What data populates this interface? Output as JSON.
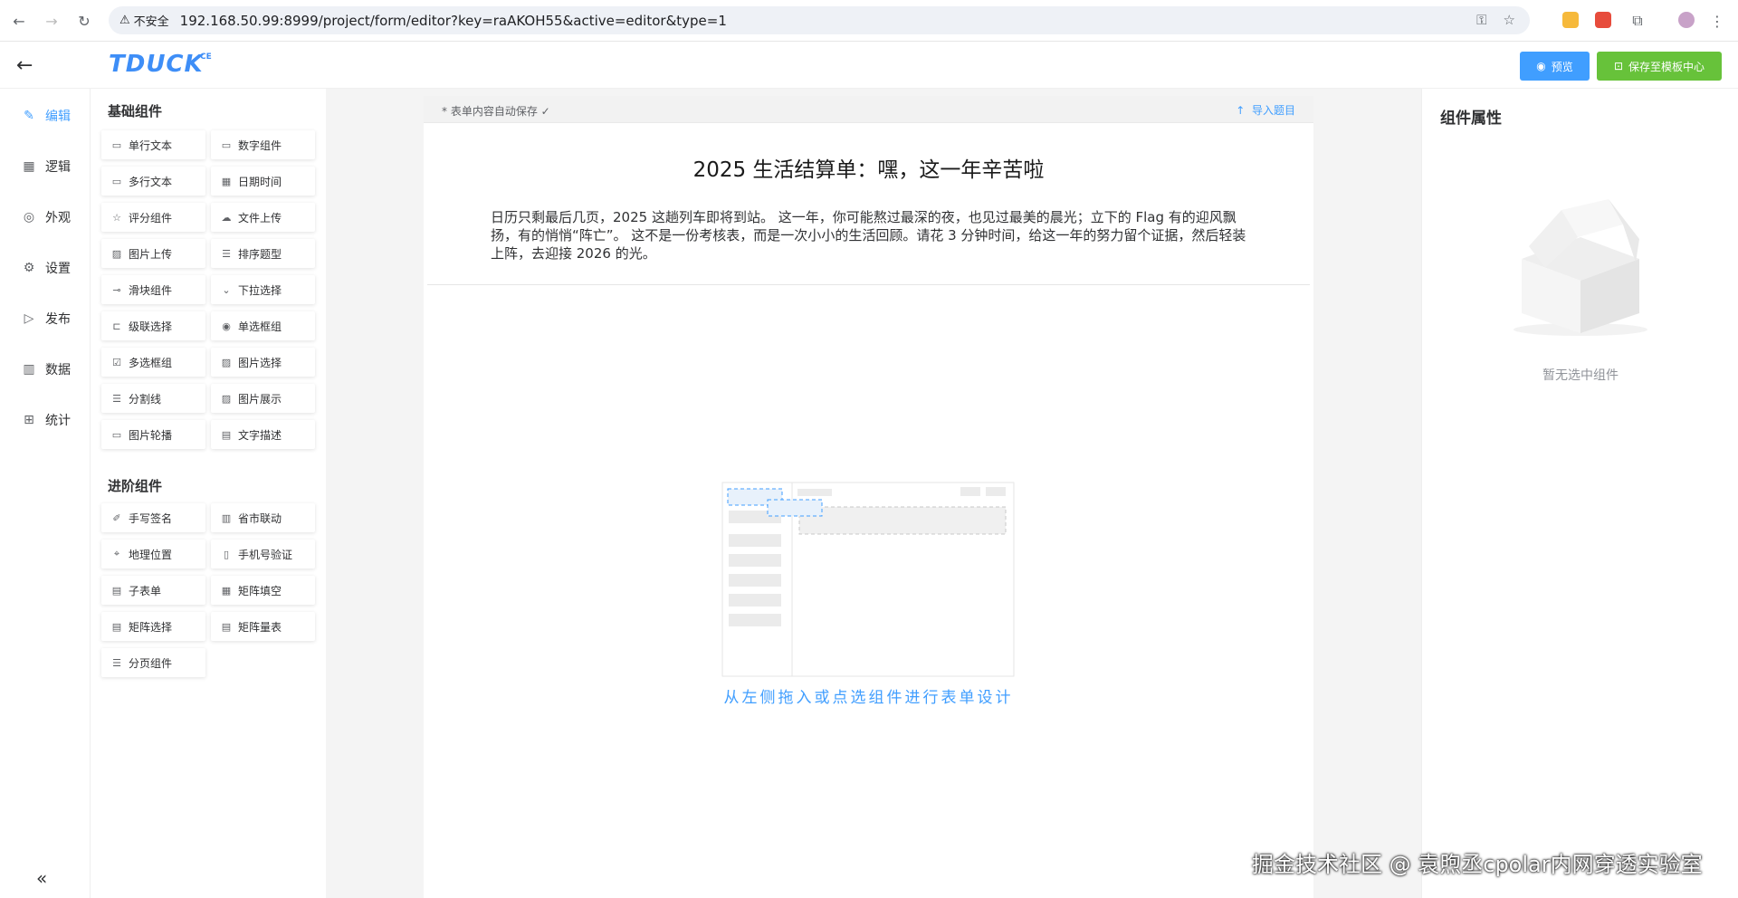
{
  "browser": {
    "insecure_label": "不安全",
    "url": "192.168.50.99:8999/project/form/editor?key=raAKOH55&active=editor&type=1"
  },
  "header": {
    "logo": "TDUCK",
    "logo_sup": "CE",
    "preview_label": "预览",
    "save_template_label": "保存至模板中心"
  },
  "left_menu": {
    "items": [
      {
        "label": "编辑",
        "icon": "edit-icon",
        "active": true
      },
      {
        "label": "逻辑",
        "icon": "logic-icon"
      },
      {
        "label": "外观",
        "icon": "eye-icon"
      },
      {
        "label": "设置",
        "icon": "gear-icon"
      },
      {
        "label": "发布",
        "icon": "publish-icon"
      },
      {
        "label": "数据",
        "icon": "bar-chart-icon"
      },
      {
        "label": "统计",
        "icon": "stats-icon"
      }
    ]
  },
  "components": {
    "basic_title": "基础组件",
    "basic": [
      {
        "label": "单行文本",
        "icon": "input-icon"
      },
      {
        "label": "数字组件",
        "icon": "number-icon"
      },
      {
        "label": "多行文本",
        "icon": "textarea-icon"
      },
      {
        "label": "日期时间",
        "icon": "calendar-icon"
      },
      {
        "label": "评分组件",
        "icon": "star-icon"
      },
      {
        "label": "文件上传",
        "icon": "cloud-upload-icon"
      },
      {
        "label": "图片上传",
        "icon": "image-icon"
      },
      {
        "label": "排序题型",
        "icon": "sort-icon"
      },
      {
        "label": "滑块组件",
        "icon": "slider-icon"
      },
      {
        "label": "下拉选择",
        "icon": "dropdown-icon"
      },
      {
        "label": "级联选择",
        "icon": "cascade-icon"
      },
      {
        "label": "单选框组",
        "icon": "radio-icon"
      },
      {
        "label": "多选框组",
        "icon": "checkbox-icon"
      },
      {
        "label": "图片选择",
        "icon": "image-select-icon"
      },
      {
        "label": "分割线",
        "icon": "divider-icon"
      },
      {
        "label": "图片展示",
        "icon": "picture-icon"
      },
      {
        "label": "图片轮播",
        "icon": "carousel-icon"
      },
      {
        "label": "文字描述",
        "icon": "text-desc-icon"
      }
    ],
    "advanced_title": "进阶组件",
    "advanced": [
      {
        "label": "手写签名",
        "icon": "signature-icon"
      },
      {
        "label": "省市联动",
        "icon": "building-icon"
      },
      {
        "label": "地理位置",
        "icon": "location-icon"
      },
      {
        "label": "手机号验证",
        "icon": "phone-icon"
      },
      {
        "label": "子表单",
        "icon": "subform-icon"
      },
      {
        "label": "矩阵填空",
        "icon": "matrix-fill-icon"
      },
      {
        "label": "矩阵选择",
        "icon": "matrix-select-icon"
      },
      {
        "label": "矩阵量表",
        "icon": "matrix-scale-icon"
      },
      {
        "label": "分页组件",
        "icon": "pagination-icon"
      }
    ]
  },
  "form": {
    "autosave_text": "* 表单内容自动保存 ✓",
    "import_label": "导入题目",
    "title": "2025 生活结算单：嘿，这一年辛苦啦",
    "description": "日历只剩最后几页，2025 这趟列车即将到站。 这一年，你可能熬过最深的夜，也见过最美的晨光；立下的 Flag 有的迎风飘扬，有的悄悄“阵亡”。 这不是一份考核表，而是一次小小的生活回顾。请花 3 分钟时间，给这一年的努力留个证据，然后轻装上阵，去迎接 2026 的光。",
    "empty_hint": "从左侧拖入或点选组件进行表单设计"
  },
  "properties": {
    "title": "组件属性",
    "empty_label": "暂无选中组件"
  },
  "watermark": "掘金技术社区 @ 袁煦丞cpolar内网穿透实验室"
}
